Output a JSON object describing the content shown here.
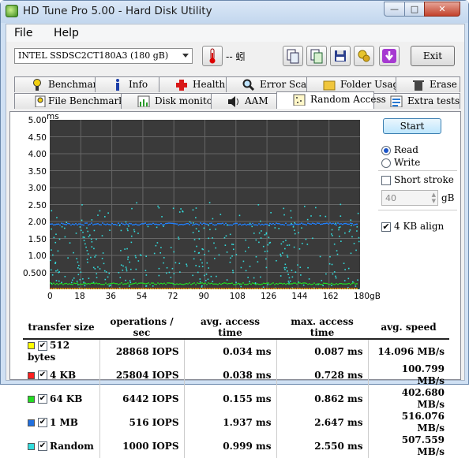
{
  "window": {
    "title": "HD Tune Pro 5.00 - Hard Disk Utility"
  },
  "menu": [
    "File",
    "Help"
  ],
  "toolbar": {
    "drive": "INTEL SSDSC2CT180A3 (180 gB)",
    "temperature": "-- 蚓",
    "exit_label": "Exit",
    "icons": [
      "thermometer-icon",
      "copy-icon",
      "copy-info-icon",
      "save-icon",
      "options-icon",
      "download-icon"
    ]
  },
  "tabs_row1": [
    "Benchmark",
    "Info",
    "Health",
    "Error Scan",
    "Folder Usage",
    "Erase"
  ],
  "tabs_row2": [
    "File Benchmark",
    "Disk monitor",
    "AAM",
    "Random Access",
    "Extra tests"
  ],
  "active_tab": "Random Access",
  "graph": {
    "y_unit": "ms",
    "y_ticks": [
      "5.00",
      "4.50",
      "4.00",
      "3.50",
      "3.00",
      "2.50",
      "2.00",
      "1.50",
      "1.00",
      "0.500"
    ],
    "x_ticks": [
      "0",
      "18",
      "36",
      "54",
      "72",
      "90",
      "108",
      "126",
      "144",
      "162",
      "180gB"
    ],
    "colors": {
      "512b": "#ffff00",
      "4k": "#ff2020",
      "64k": "#22dd22",
      "1m": "#2080ff",
      "random": "#33dddd"
    }
  },
  "controls": {
    "start_label": "Start",
    "read_label": "Read",
    "write_label": "Write",
    "read_selected": true,
    "short_stroke_label": "Short stroke",
    "short_stroke_checked": false,
    "stroke_value": "40",
    "stroke_unit": "gB",
    "align_label": "4 KB align",
    "align_checked": true
  },
  "table": {
    "headers": [
      "transfer size",
      "operations / sec",
      "avg. access time",
      "max. access time",
      "avg. speed"
    ],
    "rows": [
      {
        "color": "#ffff00",
        "size": "512 bytes",
        "ops": "28868 IOPS",
        "avg": "0.034 ms",
        "max": "0.087 ms",
        "speed": "14.096 MB/s"
      },
      {
        "color": "#ff2020",
        "size": "4 KB",
        "ops": "25804 IOPS",
        "avg": "0.038 ms",
        "max": "0.728 ms",
        "speed": "100.799 MB/s"
      },
      {
        "color": "#22dd22",
        "size": "64 KB",
        "ops": "6442 IOPS",
        "avg": "0.155 ms",
        "max": "0.862 ms",
        "speed": "402.680 MB/s"
      },
      {
        "color": "#2070e0",
        "size": "1 MB",
        "ops": "516 IOPS",
        "avg": "1.937 ms",
        "max": "2.647 ms",
        "speed": "516.076 MB/s"
      },
      {
        "color": "#33dddd",
        "size": "Random",
        "ops": "1000 IOPS",
        "avg": "0.999 ms",
        "max": "2.550 ms",
        "speed": "507.559 MB/s"
      }
    ]
  }
}
